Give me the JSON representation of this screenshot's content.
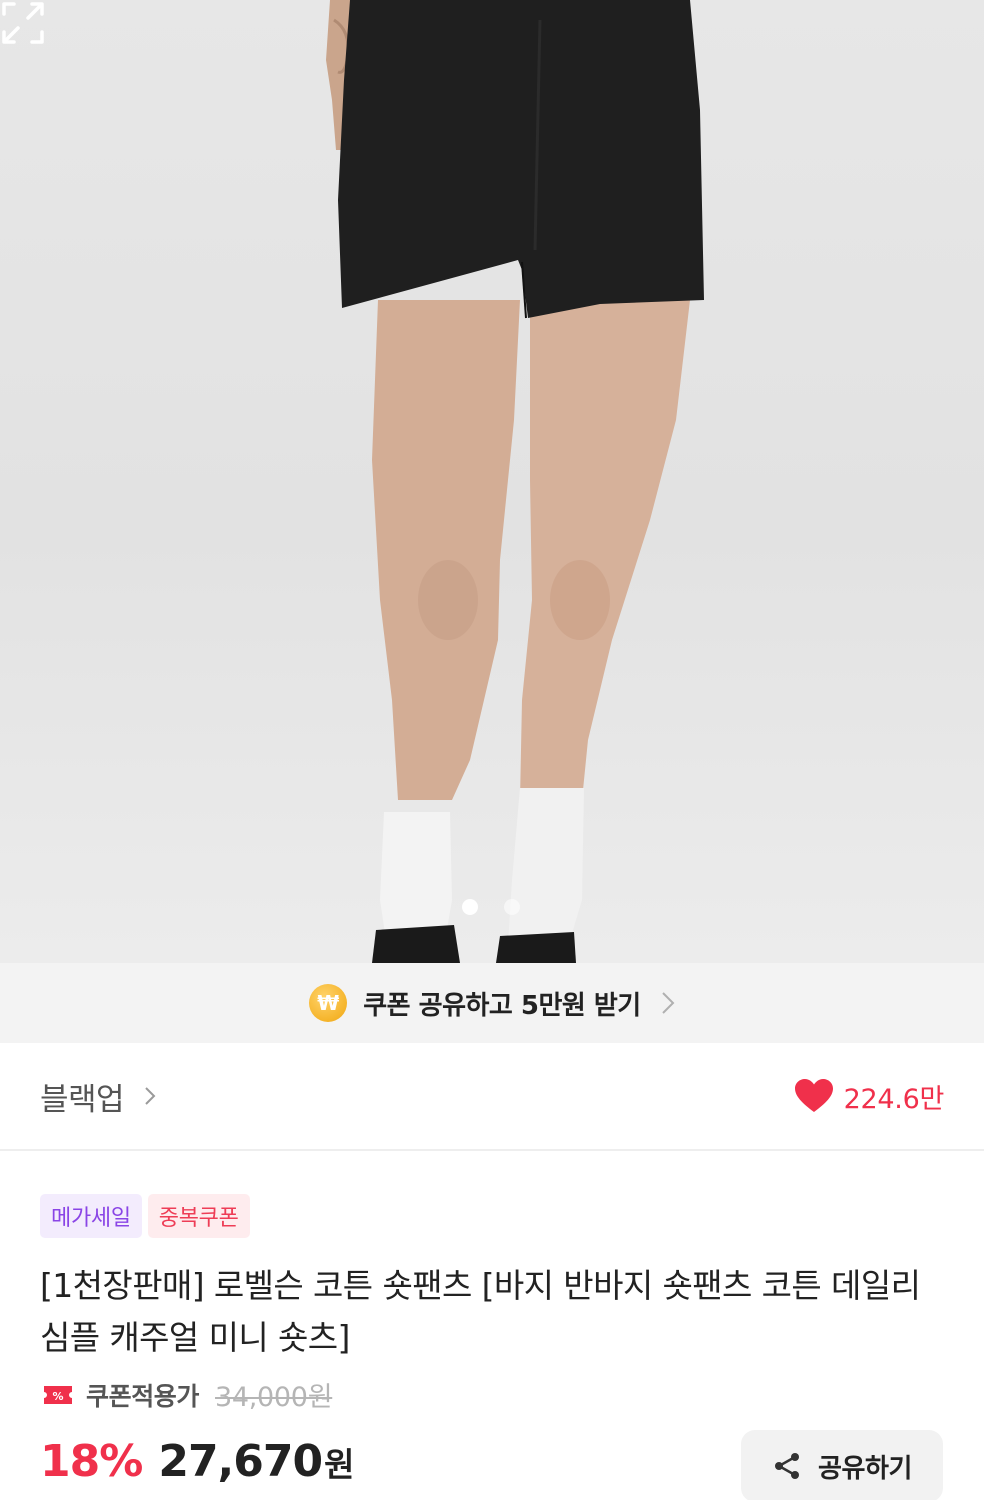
{
  "gallery": {
    "active_index": 0,
    "total": 2
  },
  "coupon_banner": {
    "icon_symbol": "₩",
    "text": "쿠폰 공유하고 5만원 받기"
  },
  "brand": {
    "name": "블랙업",
    "likes": "224.6만"
  },
  "product": {
    "tags": [
      "메가세일",
      "중복쿠폰"
    ],
    "title": "[1천장판매] 로벨슨 코튼 숏팬츠 [바지 반바지 숏팬츠 코튼 데일리 심플 캐주얼 미니 숏츠]",
    "coupon_label": "쿠폰적용가",
    "original_price": "34,000원",
    "discount": "18%",
    "price": "27,670",
    "currency": "원"
  },
  "share": {
    "label": "공유하기"
  },
  "colors": {
    "accent_red": "#f0304b",
    "mega_purple": "#8a45e6",
    "coin_gold": "#f5b42a"
  }
}
